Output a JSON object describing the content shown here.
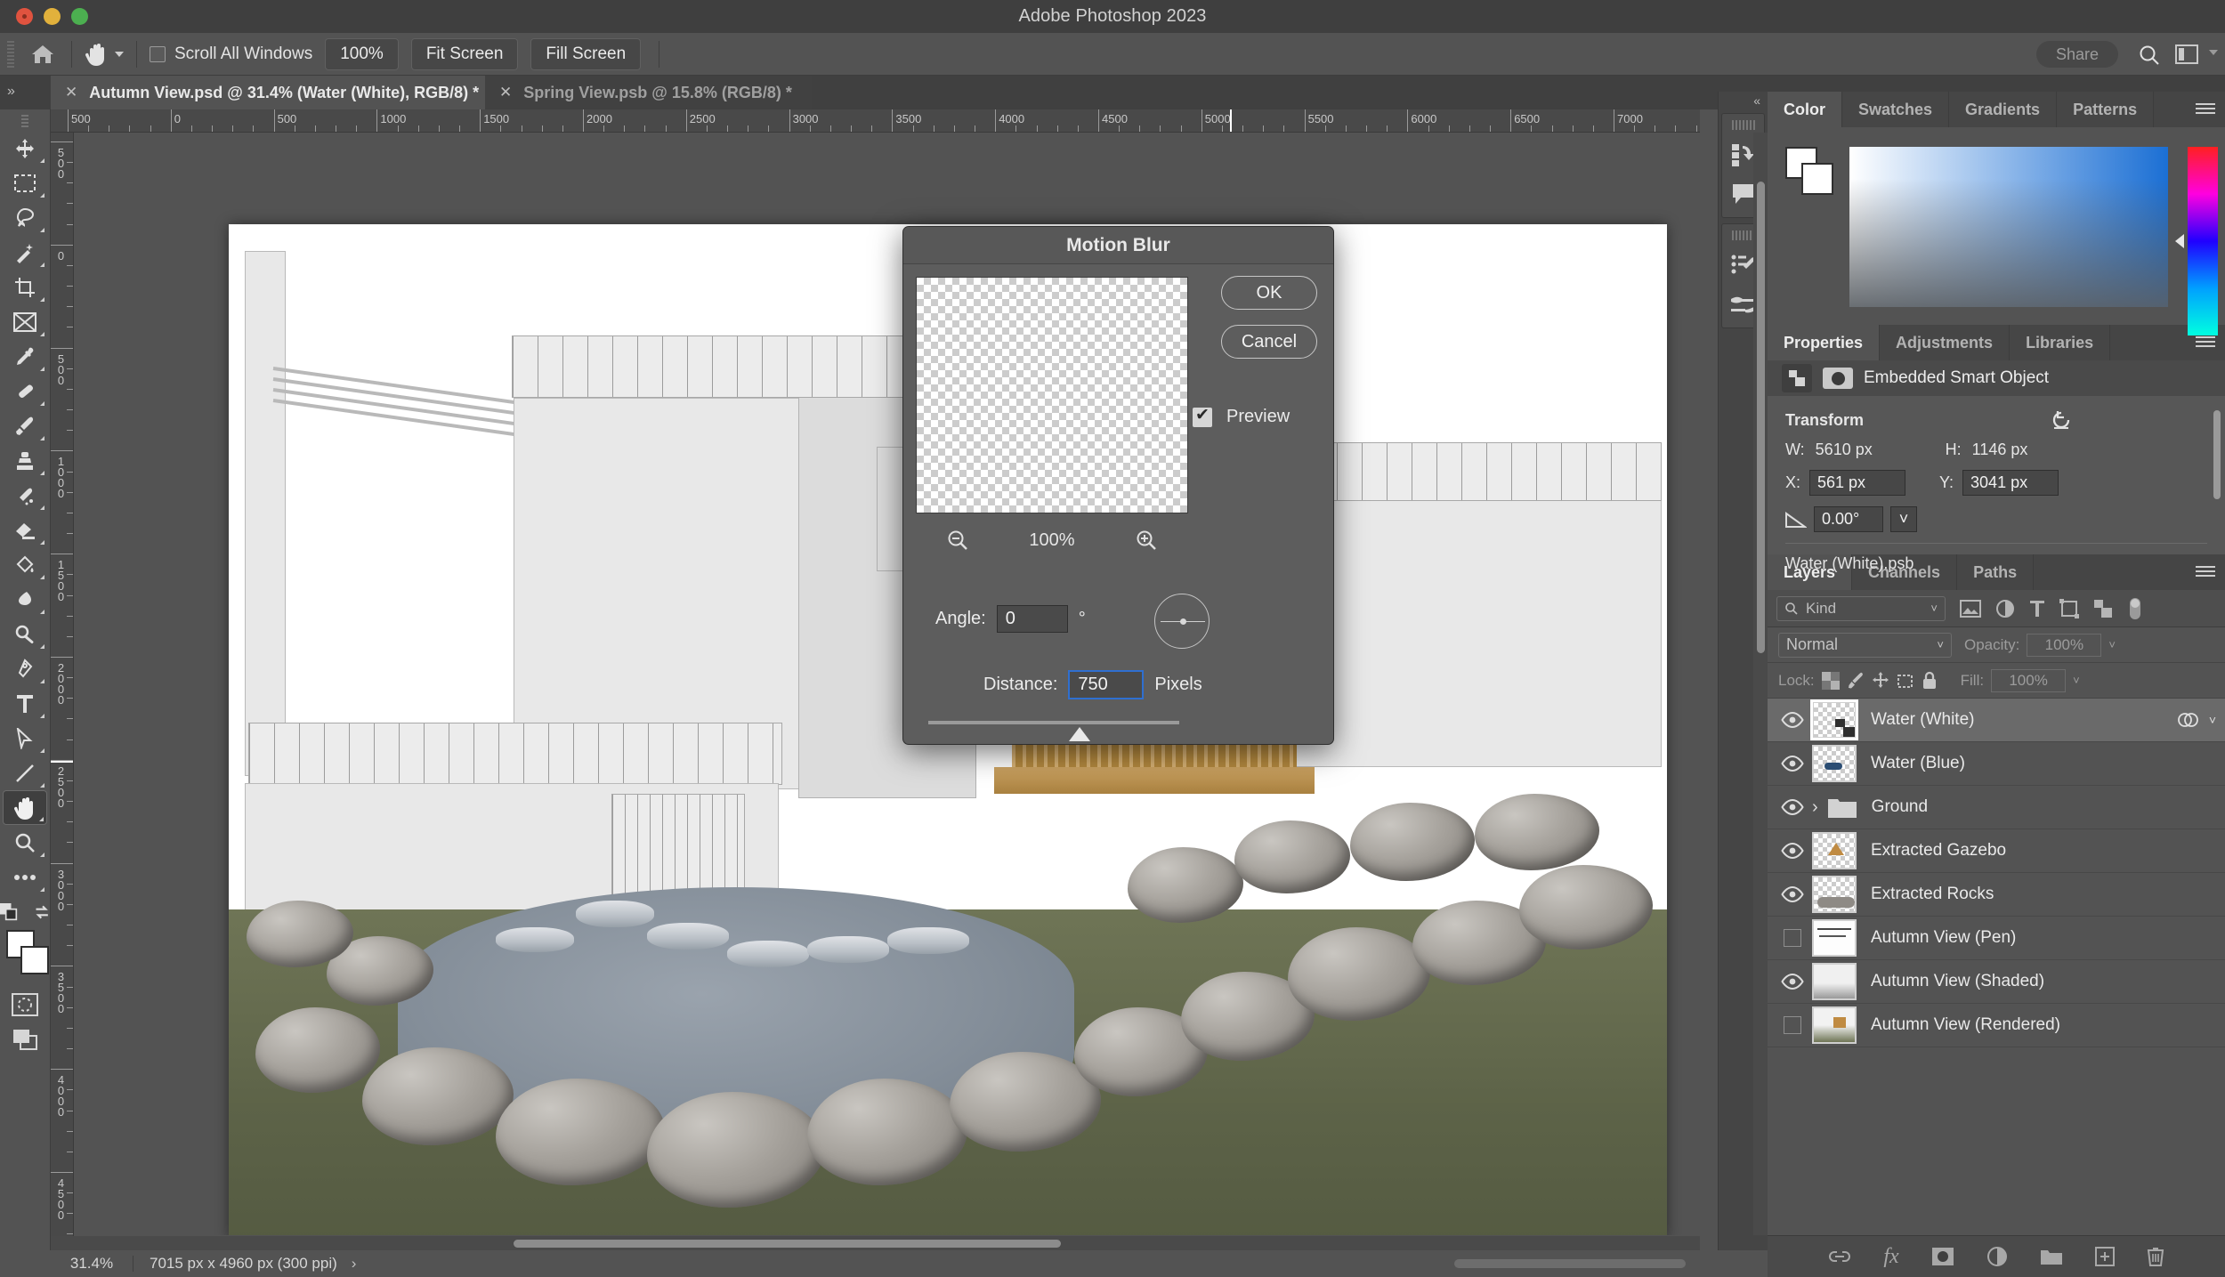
{
  "window": {
    "app_title": "Adobe Photoshop 2023"
  },
  "options_bar": {
    "home_icon": "home-icon",
    "active_tool_icon": "hand-tool-icon",
    "tool_dropdown_icon": "chevron-down-icon",
    "scroll_all_windows_label": "Scroll All Windows",
    "scroll_all_windows_checked": false,
    "buttons": [
      "100%",
      "Fit Screen",
      "Fill Screen"
    ],
    "share_label": "Share",
    "search_icon": "search-icon",
    "workspace_icon": "workspace-switcher-icon"
  },
  "tabs": [
    {
      "title": "Autumn View.psd @ 31.4% (Water (White), RGB/8) *",
      "active": true,
      "close_icon": "close-icon"
    },
    {
      "title": "Spring View.psb @ 15.8% (RGB/8) *",
      "active": false,
      "close_icon": "close-icon"
    }
  ],
  "toolbar": {
    "tools": [
      {
        "name": "move-tool",
        "icon": "move-icon",
        "selected": false
      },
      {
        "name": "rectangular-marquee-tool",
        "icon": "marquee-icon",
        "selected": false
      },
      {
        "name": "lasso-tool",
        "icon": "lasso-icon",
        "selected": false
      },
      {
        "name": "object-selection-tool",
        "icon": "magic-wand-icon",
        "selected": false
      },
      {
        "name": "crop-tool",
        "icon": "crop-icon",
        "selected": false
      },
      {
        "name": "frame-tool",
        "icon": "frame-icon",
        "selected": false
      },
      {
        "name": "eyedropper-tool",
        "icon": "eyedropper-icon",
        "selected": false
      },
      {
        "name": "spot-healing-brush-tool",
        "icon": "healing-brush-icon",
        "selected": false
      },
      {
        "name": "brush-tool",
        "icon": "brush-icon",
        "selected": false
      },
      {
        "name": "clone-stamp-tool",
        "icon": "clone-stamp-icon",
        "selected": false
      },
      {
        "name": "history-brush-tool",
        "icon": "history-brush-icon",
        "selected": false
      },
      {
        "name": "eraser-tool",
        "icon": "eraser-icon",
        "selected": false
      },
      {
        "name": "gradient-tool",
        "icon": "paint-bucket-icon",
        "selected": false
      },
      {
        "name": "blur-tool",
        "icon": "smudge-icon",
        "selected": false
      },
      {
        "name": "dodge-tool",
        "icon": "dodge-icon",
        "selected": false
      },
      {
        "name": "pen-tool",
        "icon": "pen-icon",
        "selected": false
      },
      {
        "name": "type-tool",
        "icon": "type-icon",
        "selected": false
      },
      {
        "name": "path-selection-tool",
        "icon": "path-arrow-icon",
        "selected": false
      },
      {
        "name": "line-tool",
        "icon": "line-icon",
        "selected": false
      },
      {
        "name": "hand-tool",
        "icon": "hand-icon",
        "selected": true
      },
      {
        "name": "zoom-tool",
        "icon": "magnifier-icon",
        "selected": false
      },
      {
        "name": "edit-toolbar",
        "icon": "ellipsis-icon",
        "selected": false
      }
    ],
    "default_colors_icon": "default-colors-icon",
    "swap_colors_icon": "swap-colors-icon",
    "foreground_color": "#ffffff",
    "background_color": "#ffffff",
    "quick_mask_icon": "quick-mask-icon",
    "screen_mode_icon": "screen-mode-icon"
  },
  "rulers": {
    "horizontal_ticks": [
      "500",
      "0",
      "500",
      "1000",
      "1500",
      "2000",
      "2500",
      "3000",
      "3500",
      "4000",
      "4500",
      "5000",
      "5500",
      "6000",
      "6500",
      "7000"
    ],
    "vertical_ticks": [
      "500",
      "0",
      "500",
      "1000",
      "1500",
      "2000",
      "2500",
      "3000",
      "3500",
      "4000",
      "4500"
    ]
  },
  "dialog": {
    "title": "Motion Blur",
    "ok_label": "OK",
    "cancel_label": "Cancel",
    "preview_label": "Preview",
    "preview_checked": true,
    "zoom_out_icon": "zoom-out-icon",
    "zoom_in_icon": "zoom-in-icon",
    "zoom_value": "100%",
    "angle_label": "Angle:",
    "angle_value": "0",
    "angle_unit": "°",
    "angle_dial_icon": "angle-dial-icon",
    "distance_label": "Distance:",
    "distance_value": "750",
    "distance_unit": "Pixels"
  },
  "dock_icons": [
    {
      "name": "history-panel-icon"
    },
    {
      "name": "comments-panel-icon"
    },
    {
      "name": "brush-settings-icon"
    },
    {
      "name": "brushes-panel-icon"
    }
  ],
  "color_panel": {
    "tabs": [
      {
        "label": "Color",
        "active": true
      },
      {
        "label": "Swatches",
        "active": false
      },
      {
        "label": "Gradients",
        "active": false
      },
      {
        "label": "Patterns",
        "active": false
      }
    ],
    "menu_icon": "panel-menu-icon",
    "foreground_color": "#ffffff",
    "background_color": "#ffffff",
    "ramp_accent": "#1b6fd4"
  },
  "properties_panel": {
    "tabs": [
      {
        "label": "Properties",
        "active": true
      },
      {
        "label": "Adjustments",
        "active": false
      },
      {
        "label": "Libraries",
        "active": false
      }
    ],
    "menu_icon": "panel-menu-icon",
    "object_type": "Embedded Smart Object",
    "smart_object_icon": "smart-object-icon",
    "mask_icon": "mask-thumbnail-icon",
    "transform_label": "Transform",
    "reset_icon": "reset-transform-icon",
    "w_label": "W:",
    "w_value": "5610 px",
    "h_label": "H:",
    "h_value": "1146 px",
    "x_label": "X:",
    "x_value": "561 px",
    "y_label": "Y:",
    "y_value": "3041 px",
    "angle_icon": "rotate-angle-icon",
    "angle_value": "0.00°",
    "angle_dropdown_icon": "chevron-down-icon",
    "source_file": "Water (White).psb"
  },
  "layers_panel": {
    "tabs": [
      {
        "label": "Layers",
        "active": true
      },
      {
        "label": "Channels",
        "active": false
      },
      {
        "label": "Paths",
        "active": false
      }
    ],
    "menu_icon": "panel-menu-icon",
    "filter_label": "Kind",
    "filter_search_icon": "search-icon",
    "filter_icons": [
      "filter-pixel-icon",
      "filter-adjustment-icon",
      "filter-type-icon",
      "filter-shape-icon",
      "filter-smart-object-icon"
    ],
    "filter_toggle_icon": "filter-toggle-icon",
    "blend_mode": "Normal",
    "blend_dropdown_icon": "chevron-down-icon",
    "opacity_label": "Opacity:",
    "opacity_value": "100%",
    "lock_label": "Lock:",
    "lock_icons": [
      "lock-transparency-icon",
      "lock-image-icon",
      "lock-position-icon",
      "lock-artboard-icon",
      "lock-all-icon"
    ],
    "fill_label": "Fill:",
    "fill_value": "100%",
    "layers": [
      {
        "name": "Water (White)",
        "visible": true,
        "selected": true,
        "type": "smart-object",
        "has_fx": true
      },
      {
        "name": "Water (Blue)",
        "visible": true,
        "selected": false,
        "type": "pixel"
      },
      {
        "name": "Ground",
        "visible": true,
        "selected": false,
        "type": "group"
      },
      {
        "name": "Extracted Gazebo",
        "visible": true,
        "selected": false,
        "type": "pixel"
      },
      {
        "name": "Extracted Rocks",
        "visible": true,
        "selected": false,
        "type": "pixel"
      },
      {
        "name": "Autumn View (Pen)",
        "visible": false,
        "selected": false,
        "type": "pixel"
      },
      {
        "name": "Autumn View (Shaded)",
        "visible": true,
        "selected": false,
        "type": "pixel"
      },
      {
        "name": "Autumn View (Rendered)",
        "visible": false,
        "selected": false,
        "type": "pixel"
      }
    ],
    "bottom_icons": [
      "link-layers-icon",
      "layer-style-fx-icon",
      "add-mask-icon",
      "adjustment-layer-icon",
      "new-group-icon",
      "new-layer-icon",
      "delete-layer-icon"
    ]
  },
  "status_bar": {
    "zoom": "31.4%",
    "doc_size": "7015 px x 4960 px (300 ppi)",
    "expand_icon": "chevron-right-icon"
  }
}
